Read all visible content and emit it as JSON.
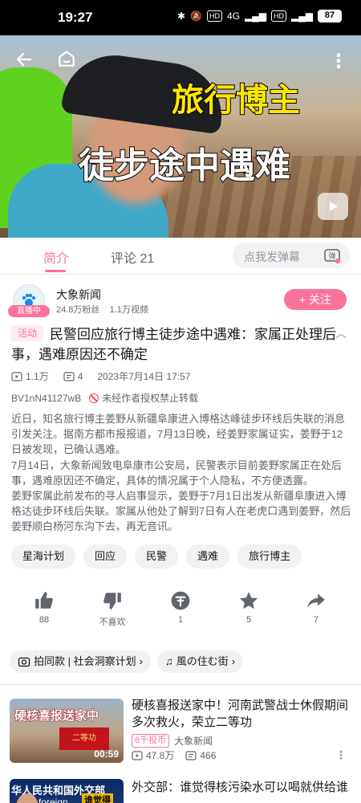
{
  "status_bar": {
    "time": "19:27",
    "network": "4G",
    "battery": "87"
  },
  "video": {
    "overlay_line1": "旅行博主",
    "overlay_line2": "徒步途中遇难"
  },
  "tabs": [
    {
      "label": "简介",
      "active": true
    },
    {
      "label": "评论 21",
      "active": false
    }
  ],
  "danmaku": {
    "placeholder": "点我发弹幕",
    "toggle_label": "弹"
  },
  "uploader": {
    "name": "大象新闻",
    "fans": "24.8万粉丝",
    "videos": "1.1万视频",
    "live_badge": "直播中",
    "follow_label": "+ 关注"
  },
  "video_info": {
    "tag": "活动",
    "title": "民警回应旅行博主徒步途中遇难：家属正处理后事，遇难原因还不确定",
    "views": "1.1万",
    "danmaku_count": "4",
    "date": "2023年7月14日 17:57",
    "bvid": "BV1nN41127wB",
    "copyright": "未经作者授权禁止转载",
    "description": [
      "近日，知名旅行博主姜野从新疆阜康进入博格达峰徒步环线后失联的消息引发关注。据南方都市报报道，7月13日晚，经姜野家属证实，姜野于12日被发现，已确认遇难。",
      "7月14日，大象新闻致电阜康市公安局，民警表示目前姜野家属正在处后事，遇难原因还不确定，具体的情况属于个人隐私，不方便透露。",
      "姜野家属此前发布的寻人启事显示，姜野于7月1日出发从新疆阜康进入博格达徒步环线后失联。家属从他处了解到7日有人在老虎口遇到姜野，然后姜野顺白杨河东沟下去，再无音讯。"
    ],
    "tags": [
      "星海计划",
      "回应",
      "民警",
      "遇难",
      "旅行博主"
    ]
  },
  "actions": [
    {
      "name": "like",
      "count": "88"
    },
    {
      "name": "dislike",
      "count": "不喜欢"
    },
    {
      "name": "coin",
      "count": "1"
    },
    {
      "name": "favorite",
      "count": "5"
    },
    {
      "name": "share",
      "count": "7"
    }
  ],
  "pills": [
    {
      "label": "拍同款 | 社会洞察计划"
    },
    {
      "label": "風の住む街"
    }
  ],
  "recommendations": [
    {
      "thumb_text": "硬核喜报送家中",
      "thumb_sign": "二等功",
      "duration": "00:59",
      "title": "硬核喜报送家中！河南武警战士休假期间多次救火，荣立二等功",
      "coin_tag": "6千投币",
      "author": "大象新闻",
      "views": "47.8万",
      "comments": "466"
    },
    {
      "thumb_text": "华人民共和国外交部",
      "thumb_sub": "foreign",
      "thumb_tag": "谁觉得",
      "title": "外交部：谁觉得核污染水可以喝就供给谁"
    }
  ]
}
